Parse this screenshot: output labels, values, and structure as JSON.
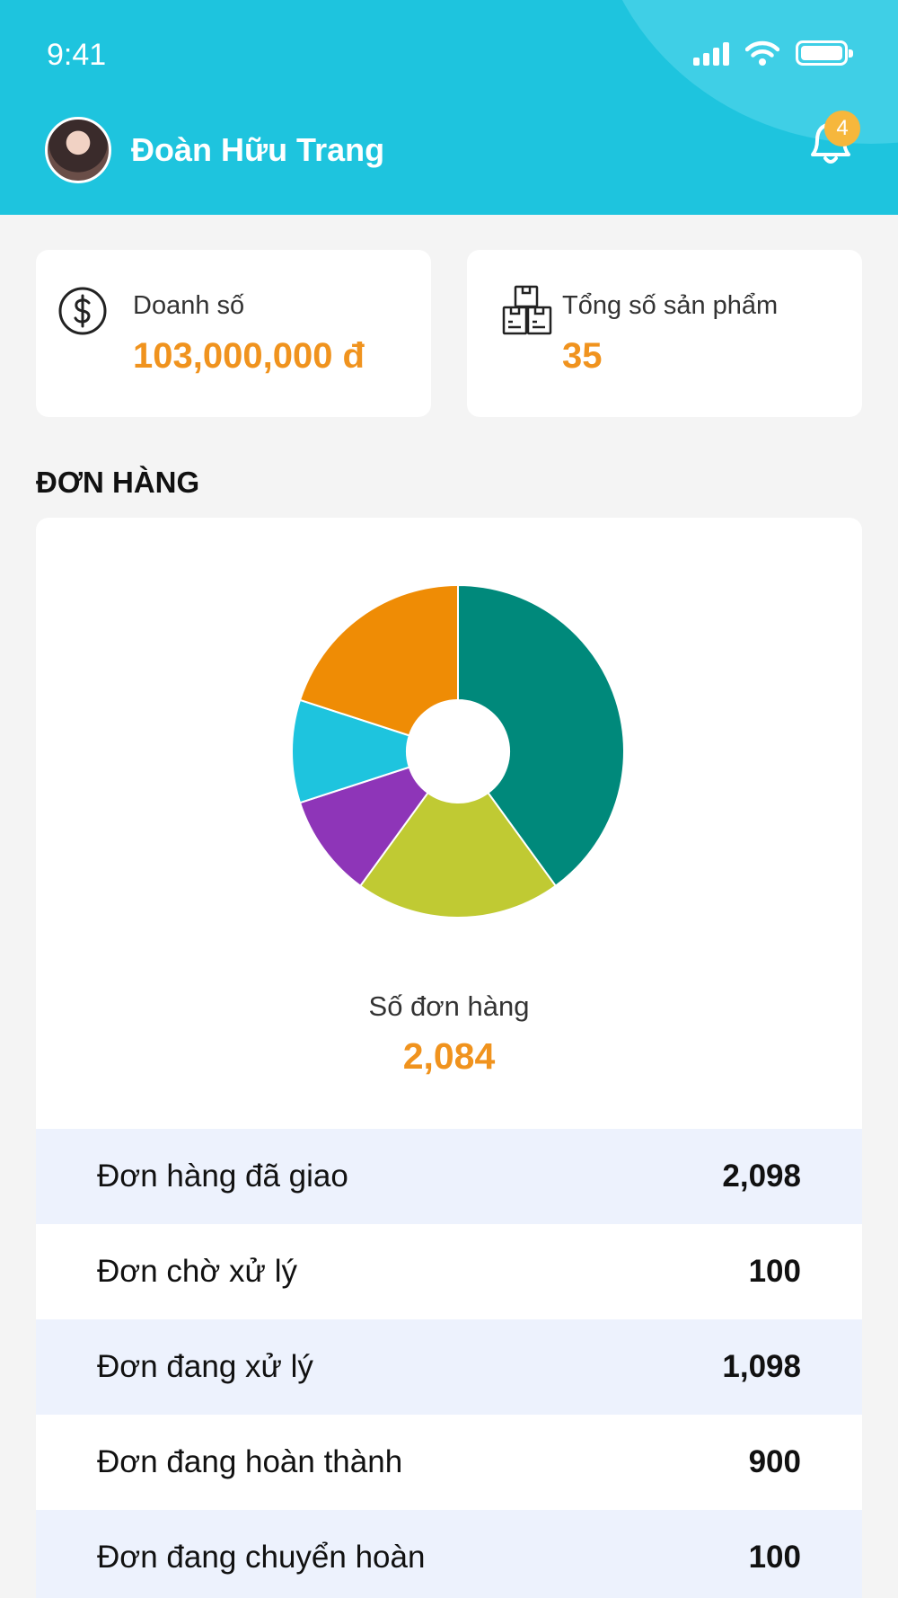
{
  "status_bar": {
    "time": "9:41"
  },
  "header": {
    "user_name": "Đoàn Hữu Trang",
    "notification_count": "4"
  },
  "stats": {
    "revenue": {
      "label": "Doanh số",
      "value": "103,000,000 đ",
      "icon": "dollar-circle-icon"
    },
    "products": {
      "label": "Tổng số sản phẩm",
      "value": "35",
      "icon": "boxes-icon"
    }
  },
  "orders": {
    "section_title": "ĐƠN HÀNG",
    "caption": "Số đơn hàng",
    "total": "2,084",
    "rows": [
      {
        "label": "Đơn hàng đã giao",
        "value": "2,098"
      },
      {
        "label": "Đơn chờ xử lý",
        "value": "100"
      },
      {
        "label": "Đơn đang xử lý",
        "value": "1,098"
      },
      {
        "label": "Đơn đang hoàn thành",
        "value": "900"
      },
      {
        "label": "Đơn đang chuyển hoàn",
        "value": "100"
      }
    ]
  },
  "colors": {
    "header": "#1ec4de",
    "accent": "#f0931e",
    "row_alt": "#edf2fd"
  },
  "chart_data": {
    "type": "pie",
    "title": "",
    "donut": true,
    "slices": [
      {
        "value": 40,
        "color": "#00897b"
      },
      {
        "value": 20,
        "color": "#c0ca33"
      },
      {
        "value": 10,
        "color": "#8e35b8"
      },
      {
        "value": 10,
        "color": "#1ec4de"
      },
      {
        "value": 20,
        "color": "#ef8c05"
      }
    ]
  }
}
